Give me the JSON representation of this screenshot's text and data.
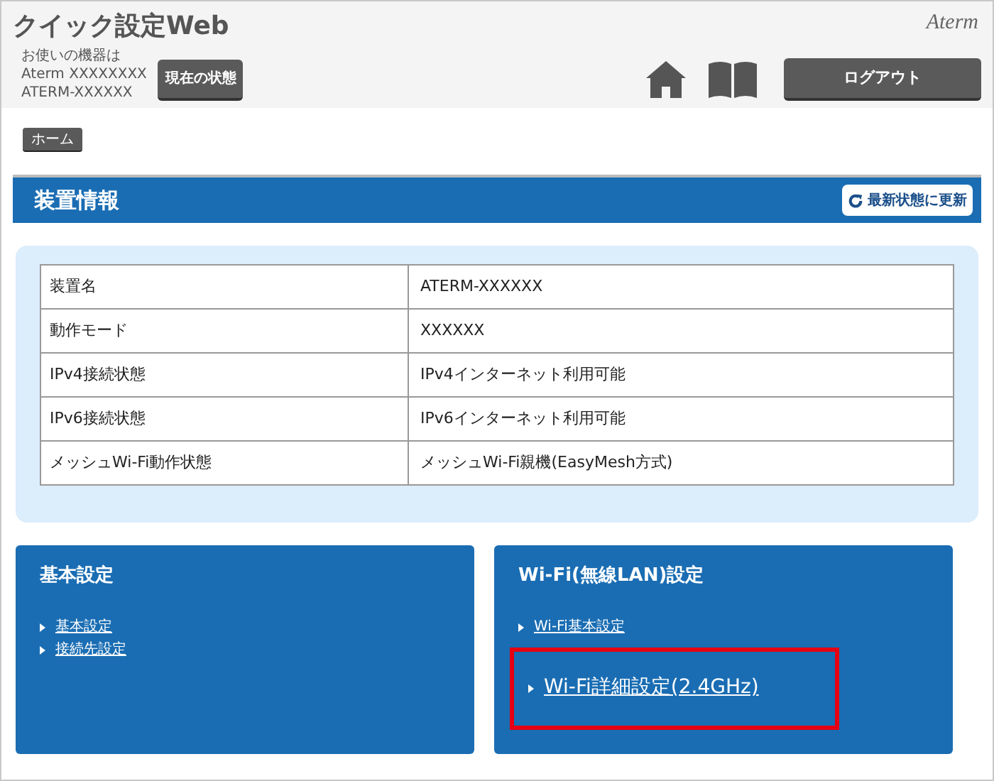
{
  "header": {
    "title": "クイック設定Web",
    "device_lines": [
      "お使いの機器は",
      "Aterm XXXXXXXX",
      "ATERM-XXXXXX"
    ],
    "status_button": "現在の状態",
    "logo": "Aterm",
    "logout_button": "ログアウト"
  },
  "breadcrumb": [
    "ホーム"
  ],
  "device_info": {
    "title": "装置情報",
    "refresh_button": "最新状態に更新",
    "rows": [
      {
        "label": "装置名",
        "value": "ATERM-XXXXXX"
      },
      {
        "label": "動作モード",
        "value": "XXXXXX"
      },
      {
        "label": "IPv4接続状態",
        "value": "IPv4インターネット利用可能"
      },
      {
        "label": "IPv6接続状態",
        "value": "IPv6インターネット利用可能"
      },
      {
        "label": "メッシュWi-Fi動作状態",
        "value": "メッシュWi-Fi親機(EasyMesh方式)"
      }
    ]
  },
  "cards": [
    {
      "title": "基本設定",
      "links": [
        {
          "label": "基本設定",
          "highlighted": false
        },
        {
          "label": "接続先設定",
          "highlighted": false
        }
      ]
    },
    {
      "title": "Wi-Fi(無線LAN)設定",
      "links": [
        {
          "label": "Wi-Fi基本設定",
          "highlighted": false
        },
        {
          "label": "Wi-Fi詳細設定(2.4GHz)",
          "highlighted": true
        }
      ]
    }
  ]
}
